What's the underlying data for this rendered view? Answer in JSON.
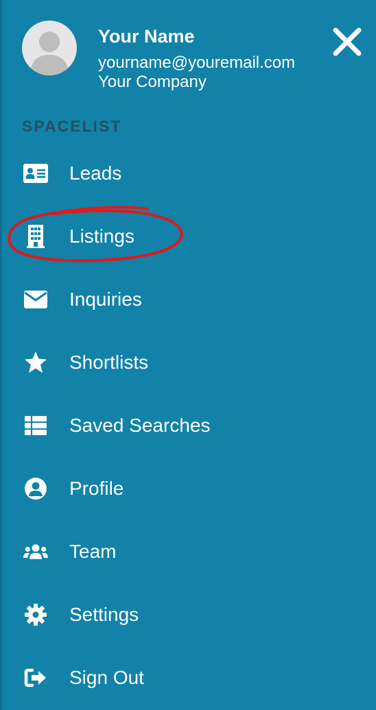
{
  "user": {
    "name": "Your Name",
    "email": "yourname@youremail.com",
    "company": "Your Company"
  },
  "section_label": "SPACELIST",
  "nav": [
    {
      "label": "Leads",
      "icon": "id-card-icon"
    },
    {
      "label": "Listings",
      "icon": "building-icon",
      "highlighted": true
    },
    {
      "label": "Inquiries",
      "icon": "envelope-icon"
    },
    {
      "label": "Shortlists",
      "icon": "star-icon"
    },
    {
      "label": "Saved Searches",
      "icon": "list-icon"
    },
    {
      "label": "Profile",
      "icon": "user-circle-icon"
    },
    {
      "label": "Team",
      "icon": "users-icon"
    },
    {
      "label": "Settings",
      "icon": "gear-icon"
    },
    {
      "label": "Sign Out",
      "icon": "sign-out-icon"
    }
  ],
  "colors": {
    "background": "#1282a8",
    "section_label": "#27506a",
    "annotation": "#e01b1b"
  }
}
